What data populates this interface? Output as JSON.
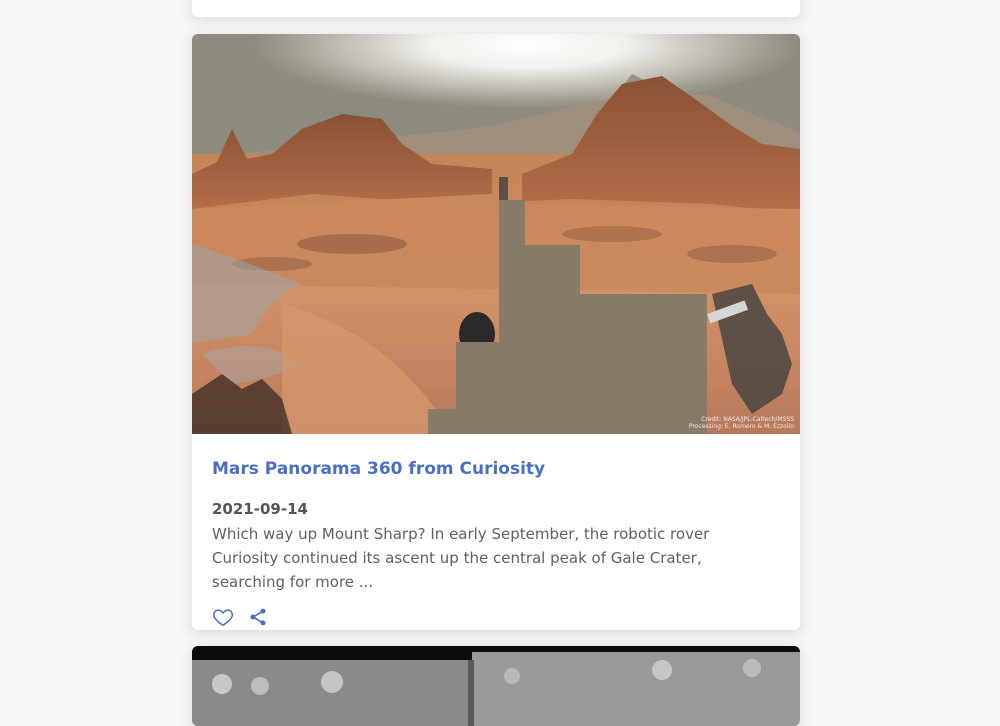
{
  "post": {
    "title": "Mars Panorama 360 from Curiosity",
    "date": "2021-09-14",
    "excerpt": "Which way up Mount Sharp? In early September, the robotic rover Curiosity continued its ascent up the central peak of Gale Crater, searching for more ...",
    "image_credit_line1": "Credit: NASA/JPL-Caltech/MSSS",
    "image_credit_line2": "Processing: E. Romero & M. Ezzolin"
  },
  "actions": {
    "like_icon": "heart-outline-icon",
    "share_icon": "share-icon"
  },
  "colors": {
    "link": "#4a6fc4",
    "background": "#f7f7f8",
    "card": "#ffffff"
  }
}
